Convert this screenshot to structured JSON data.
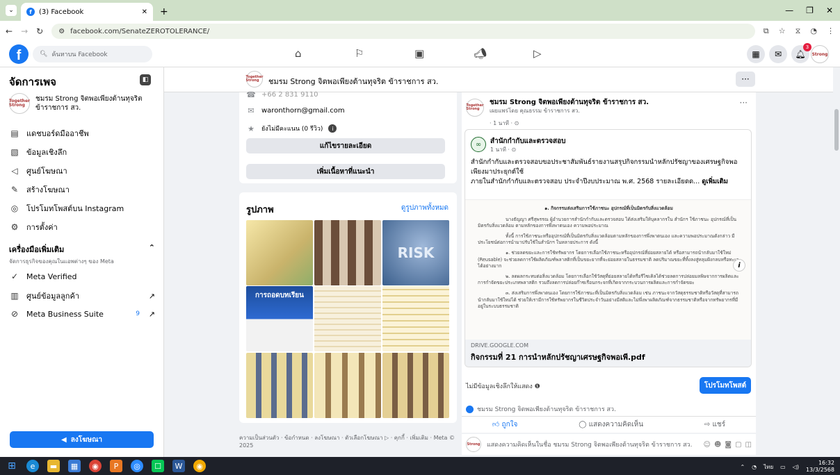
{
  "browser": {
    "tab_title": "(3) Facebook",
    "url": "facebook.com/SenateZEROTOLERANCE/"
  },
  "header": {
    "search_placeholder": "ค้นหาบน Facebook",
    "notification_count": "3"
  },
  "sidebar": {
    "title": "จัดการเพจ",
    "page_name": "ชมรม Strong จิตพอเพียงต้านทุจริต ข้าราชการ สว.",
    "items": [
      {
        "label": "แดชบอร์ดมืออาชีพ",
        "icon": "dashboard-icon"
      },
      {
        "label": "ข้อมูลเชิงลึก",
        "icon": "insights-icon"
      },
      {
        "label": "ศูนย์โฆษณา",
        "icon": "megaphone-icon"
      },
      {
        "label": "สร้างโฆษณา",
        "icon": "edit-icon"
      },
      {
        "label": "โปรโมทโพสต์บน Instagram",
        "icon": "instagram-icon"
      },
      {
        "label": "การตั้งค่า",
        "icon": "gear-icon"
      }
    ],
    "tools_title": "เครื่องมือเพิ่มเติม",
    "tools_subtitle": "จัดการธุรกิจของคุณในแอพต่างๆ ของ Meta",
    "tools": [
      {
        "label": "Meta Verified",
        "icon": "verified-icon"
      },
      {
        "label": "ศูนย์ข้อมูลลูกค้า",
        "icon": "contacts-icon"
      },
      {
        "label": "Meta Business Suite",
        "icon": "business-suite-icon",
        "count": "9"
      }
    ],
    "advertise_button": "ลงโฆษณา"
  },
  "pagebar": {
    "name": "ชมรม Strong จิตพอเพียงต้านทุจริต ข้าราชการ สว.",
    "more": "···"
  },
  "intro": {
    "phone": "+66 2 831 9110",
    "email": "waronthorn@gmail.com",
    "rating": "ยังไม่มีคะแนน (0 รีวิว)",
    "edit_details": "แก้ไขรายละเอียด",
    "add_featured": "เพิ่มเนื้อหาที่แนะนำ"
  },
  "photos": {
    "title": "รูปภาพ",
    "see_all": "ดูรูปภาพทั้งหมด",
    "tile_text": [
      "RISK",
      "การถอดบทเรียน"
    ]
  },
  "footer": "ความเป็นส่วนตัว · ข้อกำหนด · ลงโฆษณา · ตัวเลือกโฆษณา ▷ · คุกกี้ · เพิ่มเติม · Meta © 2025",
  "post": {
    "author": "ชมรม Strong จิตพอเพียงต้านทุจริต ข้าราชการ สว.",
    "posted_by": "เผยแพร่โดย คุณธรรม ข้าราชการ สว.",
    "time": "· 1 นาที · ⊙",
    "shared_name": "สำนักกำกับและตรวจสอบ",
    "shared_time": "1 นาที · ⊙",
    "text_line1": "สำนักกำกับและตรวจสอบขอประชาสัมพันธ์รายงานสรุปกิจกรรมนำหลักปรัชญาของเศรษฐกิจพอเพียงมาประยุกต์ใช้",
    "text_line2": "ภายในสำนักกำกับและตรวจสอบ ประจำปีงบประมาณ พ.ศ. 2568 รายละเอียดด...",
    "see_more": "ดูเพิ่มเติม",
    "doc_heading": "๑. กิจกรรมส่งเสริมการใช้ภาชนะ อุปกรณ์ที่เป็นมิตรกับสิ่งแวดล้อม",
    "doc_p1": "นางธัญญา ศรีสุพรรณ ผู้อำนวยการสำนักกำกับและตรวจสอบ ได้ส่งเสริมให้บุคลากรใน สำนักฯ ใช้ภาชนะ อุปกรณ์ที่เป็นมิตรกับสิ่งแวดล้อม ตามหลักของการพึ่งพาตนเอง ความพอประมาณ",
    "doc_p2": "ทั้งนี้ การใช้ภาชนะหรืออุปกรณ์ที่เป็นมิตรกับสิ่งแวดล้อมตามหลักของการพึ่งพาตนเอง และความพอประมาณดังกล่าว มีประโยชน์ต่อการนำมาปรับใช้ในสำนักฯ ในหลายประการ ดังนี้",
    "doc_p3": "๑. ช่วยลดขยะและการใช้ทรัพยากร โดยการเลือกใช้ภาชนะหรืออุปกรณ์ที่ย่อยสลายได้ หรือสามารถนำกลับมาใช้ใหม่ (Reusable) จะช่วยลดการใช้ผลิตภัณฑ์พลาสติกที่เป็นขยะยากที่จะย่อยสลายในธรรมชาติ ลดปริมาณขยะที่ทิ้งลงสู่หลุมฝังกลบหรือทะเลได้อย่างมาก",
    "doc_p4": "๒. ลดผลกระทบต่อสิ่งแวดล้อม โดยการเลือกใช้วัสดุที่ย่อยสลายได้หรือรีไซเคิลได้ช่วยลดการปล่อยมลพิษจากการผลิตและการกำจัดขยะประเภทพลาสติก รวมถึงลดการปล่อยก๊าซเรือนกระจกที่เกิดจากกระบวนการผลิตและการกำจัดขยะ",
    "doc_p5": "๓. ส่งเสริมการพึ่งพาตนเอง โดยการใช้ภาชนะที่เป็นมิตรกับสิ่งแวดล้อม เช่น ภาชนะจากวัสดุธรรมชาติหรือวัสดุที่สามารถนำกลับมาใช้ใหม่ได้ ช่วยให้เรามีการใช้ทรัพยากรในชีวิตประจำวันอย่างมีสติและไม่พึ่งพาผลิตภัณฑ์จากธรรมชาติหรือจากทรัพยากรที่มีอยู่ในระบบธรรมชาติ",
    "link_domain": "DRIVE.GOOGLE.COM",
    "link_title": "กิจกรรมที่ 21 การนำหลักปรัชญาเศรษฐกิจพอเพี.pdf",
    "no_insights": "ไม่มีข้อมูลเชิงลึกให้แสดง",
    "promote": "โปรโมทโพสต์",
    "reactor": "ชมรม Strong จิตพอเพียงต้านทุจริต ข้าราชการ สว.",
    "like": "ถูกใจ",
    "comment": "แสดงความคิดเห็น",
    "share": "แชร์",
    "comment_placeholder": "แสดงความคิดเห็นในชื่อ ชมรม Strong จิตพอเพียงต้านทุจริต ข้าราชการ สว."
  },
  "taskbar": {
    "lang": "ไทย",
    "time": "16:32",
    "date": "13/3/2568"
  },
  "colors": {
    "accent": "#1877f2",
    "tab_bg": "#cfe0c8",
    "page_bg": "#f0f2f5"
  }
}
